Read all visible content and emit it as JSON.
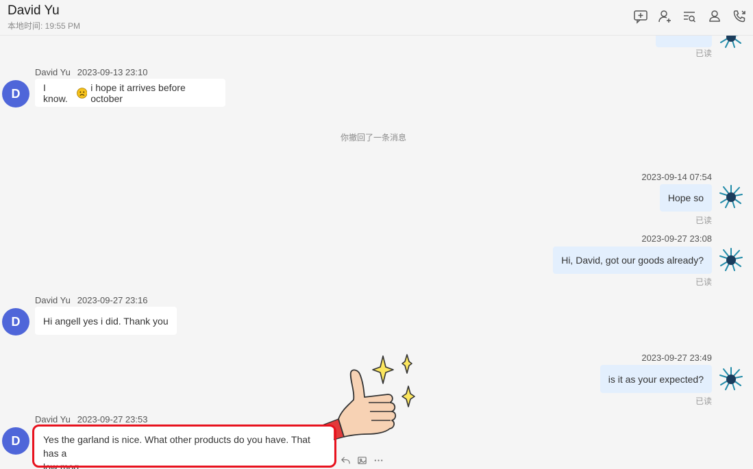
{
  "header": {
    "contact_name": "David Yu",
    "local_time": "本地时间: 19:55 PM",
    "icons": [
      "add-message-icon",
      "add-contact-icon",
      "search-history-icon",
      "user-settings-icon",
      "call-icon"
    ]
  },
  "messages": {
    "m0": {
      "read": "已读"
    },
    "m1": {
      "sender": "David Yu",
      "time": "2023-09-13 23:10",
      "avatar": "D",
      "text_before": "I know.",
      "emoji": "frown-face",
      "text_after": "i hope it arrives before october"
    },
    "recall_notice": "你撤回了一条消息",
    "m2": {
      "time": "2023-09-14 07:54",
      "text": "Hope so",
      "read": "已读"
    },
    "m3": {
      "time": "2023-09-27 23:08",
      "text": "Hi, David, got our goods already?",
      "read": "已读"
    },
    "m4": {
      "sender": "David Yu",
      "time": "2023-09-27 23:16",
      "avatar": "D",
      "text": "Hi angell yes i did. Thank you"
    },
    "m5": {
      "time": "2023-09-27 23:49",
      "text": "is it as your expected?",
      "read": "已读"
    },
    "m6": {
      "sender": "David Yu",
      "time": "2023-09-27 23:53",
      "avatar": "D",
      "text_line1": "Yes the garland is nice. What other products do you have. That has a",
      "text_line2": "low moq"
    }
  },
  "message_actions": [
    "reply-icon",
    "image-icon",
    "more-icon"
  ],
  "colors": {
    "avatar_blue": "#4f66d9",
    "outgoing_bubble": "#e3effd",
    "highlight_red": "#e8121e"
  }
}
